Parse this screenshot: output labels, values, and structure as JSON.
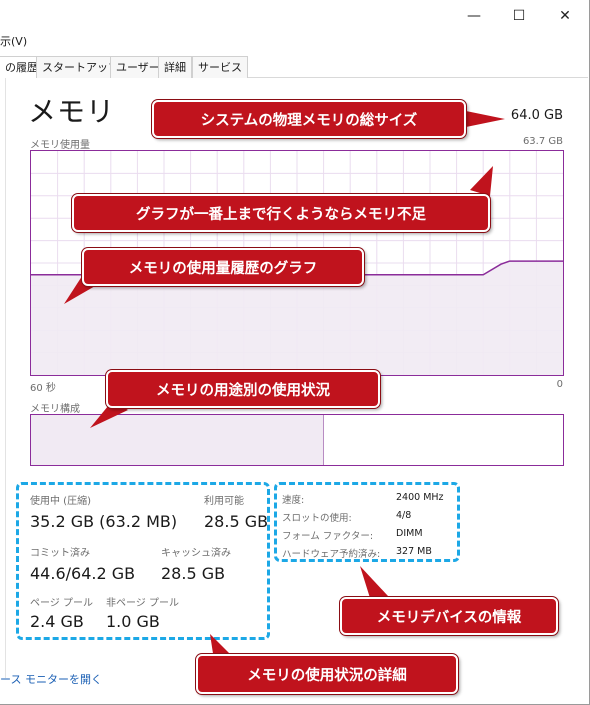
{
  "window": {
    "minimize_glyph": "—",
    "maximize_glyph": "☐",
    "close_glyph": "✕"
  },
  "menubar": {
    "view_label": "示(V)"
  },
  "tabs": [
    {
      "label": "の履歴"
    },
    {
      "label": "スタートアップ"
    },
    {
      "label": "ユーザー"
    },
    {
      "label": "詳細"
    },
    {
      "label": "サービス"
    }
  ],
  "memory": {
    "title": "メモリ",
    "total": "64.0 GB",
    "usage_label": "メモリ使用量",
    "usage_max": "63.7 GB",
    "time_left": "60 秒",
    "time_right": "0",
    "composition_label": "メモリ構成",
    "composition_used_fraction": 0.55,
    "usage_series": [
      {
        "t": 60,
        "gb": 28.5
      },
      {
        "t": 9,
        "gb": 28.5
      },
      {
        "t": 7,
        "gb": 31.5
      },
      {
        "t": 6,
        "gb": 32.4
      },
      {
        "t": 0,
        "gb": 32.4
      }
    ],
    "colors": {
      "accent": "#8b2c9a",
      "fill": "#f1eaf3"
    }
  },
  "stats": {
    "in_use_label": "使用中 (圧縮)",
    "in_use_value": "35.2 GB (63.2 MB)",
    "available_label": "利用可能",
    "available_value": "28.5 GB",
    "committed_label": "コミット済み",
    "committed_value": "44.6/64.2 GB",
    "cached_label": "キャッシュ済み",
    "cached_value": "28.5 GB",
    "paged_pool_label": "ページ プール",
    "paged_pool_value": "2.4 GB",
    "nonpaged_pool_label": "非ページ プール",
    "nonpaged_pool_value": "1.0 GB"
  },
  "device": {
    "speed_label": "速度:",
    "speed_value": "2400 MHz",
    "slots_label": "スロットの使用:",
    "slots_value": "4/8",
    "form_factor_label": "フォーム ファクター:",
    "form_factor_value": "DIMM",
    "hw_reserved_label": "ハードウェア予約済み:",
    "hw_reserved_value": "327 MB"
  },
  "footer": {
    "link": "ース モニターを開く"
  },
  "annotations": {
    "total_size": "システムの物理メモリの総サイズ",
    "shortage": "グラフが一番上まで行くようならメモリ不足",
    "history_graph": "メモリの使用量履歴のグラフ",
    "composition": "メモリの用途別の使用状況",
    "device_info": "メモリデバイスの情報",
    "usage_details": "メモリの使用状況の詳細",
    "color": "#c0131d",
    "dash_color": "#1ca8e6"
  }
}
